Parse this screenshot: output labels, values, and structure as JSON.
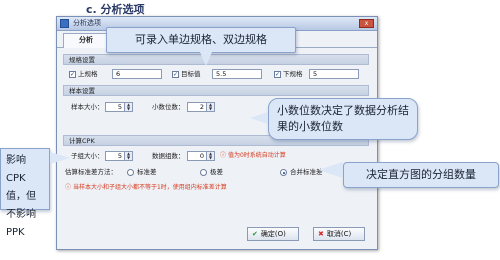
{
  "page": {
    "heading": "c. 分析选项"
  },
  "dialog": {
    "title": "分析选项",
    "close_symbol": "x",
    "tab": "分析",
    "spec_section": {
      "title": "规格设置",
      "usl_label": "上规格",
      "usl_value": "6",
      "target_label": "目标值",
      "target_value": "5.5",
      "lsl_label": "下规格",
      "lsl_value": "5"
    },
    "sample_section": {
      "title": "样本设置",
      "size_label": "样本大小：",
      "size_value": "5",
      "decimals_label": "小数位数：",
      "decimals_value": "2"
    },
    "cpk_section": {
      "title": "计算CPK",
      "subgroup_label": "子组大小：",
      "subgroup_value": "5",
      "groups_label": "数据组数：",
      "groups_value": "0",
      "groups_note": "值为0时系统自动计算",
      "sd_method_label": "估算标准差方法：",
      "method_options": [
        "标准差",
        "极差",
        "合并标准差"
      ],
      "selected_method": "合并标准差",
      "warning": "当样本大小和子组大小都不等于1时，使用组内标准差计算"
    },
    "buttons": {
      "ok": "确定(O)",
      "cancel": "取消(C)"
    },
    "colors": {
      "note": "#d63a1f",
      "ok_icon": "#2a9a2a",
      "cancel_icon": "#d32f2f"
    }
  },
  "callouts": {
    "top": "可录入单边规格、双边规格",
    "decimals": "小数位数决定了数据分析结果的小数位数",
    "groups": "决定直方图的分组数量",
    "cpk": "影响CPK值，但不影响PPK"
  }
}
